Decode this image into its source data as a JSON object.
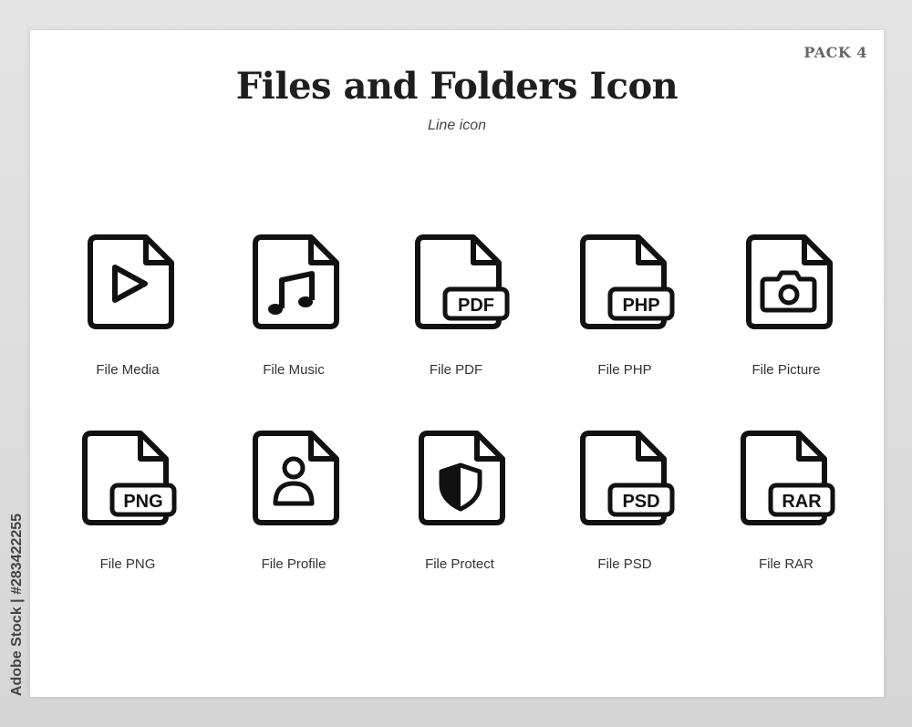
{
  "header": {
    "pack_label": "PACK 4",
    "title": "Files and Folders Icon",
    "subtitle": "Line icon"
  },
  "icons": [
    {
      "label": "File Media",
      "icon": "file-media-icon"
    },
    {
      "label": "File Music",
      "icon": "file-music-icon"
    },
    {
      "label": "File PDF",
      "icon": "file-pdf-icon",
      "tag": "PDF"
    },
    {
      "label": "File PHP",
      "icon": "file-php-icon",
      "tag": "PHP"
    },
    {
      "label": "File Picture",
      "icon": "file-picture-icon"
    },
    {
      "label": "File PNG",
      "icon": "file-png-icon",
      "tag": "PNG"
    },
    {
      "label": "File Profile",
      "icon": "file-profile-icon"
    },
    {
      "label": "File Protect",
      "icon": "file-protect-icon"
    },
    {
      "label": "File PSD",
      "icon": "file-psd-icon",
      "tag": "PSD"
    },
    {
      "label": "File RAR",
      "icon": "file-rar-icon",
      "tag": "RAR"
    }
  ],
  "watermark": "Adobe Stock | #283422255",
  "colors": {
    "stroke": "#111111",
    "background": "#ffffff",
    "frame": "#dcdcdc"
  }
}
